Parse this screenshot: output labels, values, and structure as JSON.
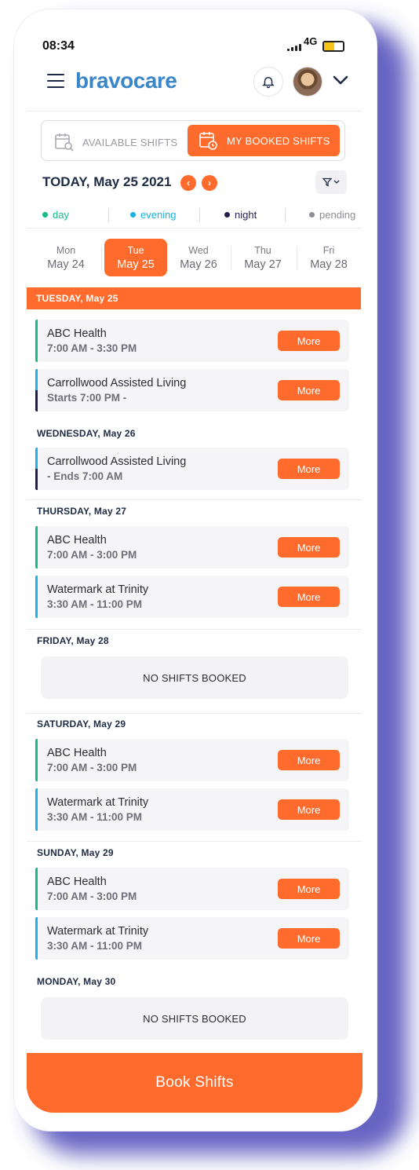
{
  "status_bar": {
    "time": "08:34",
    "network": "4G"
  },
  "header": {
    "logo": "bravocare"
  },
  "toggle": {
    "available": "AVAILABLE SHIFTS",
    "booked": "MY BOOKED SHIFTS"
  },
  "datebar": {
    "today": "TODAY, May 25 2021"
  },
  "legend": [
    {
      "label": "day",
      "color": "#16b98a"
    },
    {
      "label": "evening",
      "color": "#1bb0e3"
    },
    {
      "label": "night",
      "color": "#1f1f4a"
    },
    {
      "label": "pending",
      "color": "#8d8d96"
    }
  ],
  "days": [
    {
      "dow": "Mon",
      "date": "May 24"
    },
    {
      "dow": "Tue",
      "date": "May 25"
    },
    {
      "dow": "Wed",
      "date": "May 26"
    },
    {
      "dow": "Thu",
      "date": "May 27"
    },
    {
      "dow": "Fri",
      "date": "May 28"
    }
  ],
  "sections": {
    "tue": "TUESDAY, May 25",
    "wed": "WEDNESDAY, May 26",
    "thu": "THURSDAY, May 27",
    "fri": "FRIDAY, May 28",
    "sat": "SATURDAY, May 29",
    "sun": "SUNDAY, May 29",
    "mon": "MONDAY, May 30"
  },
  "shifts": {
    "tue1": {
      "name": "ABC Health",
      "time": "7:00 AM - 3:30 PM"
    },
    "tue2": {
      "name": "Carrollwood Assisted Living",
      "time": "Starts 7:00 PM -"
    },
    "wed1": {
      "name": "Carrollwood Assisted Living",
      "time": "- Ends 7:00 AM"
    },
    "thu1": {
      "name": "ABC Health",
      "time": "7:00 AM - 3:00 PM"
    },
    "thu2": {
      "name": "Watermark at Trinity",
      "time": "3:30 AM - 11:00 PM"
    },
    "sat1": {
      "name": "ABC Health",
      "time": "7:00 AM - 3:00 PM"
    },
    "sat2": {
      "name": "Watermark at Trinity",
      "time": "3:30 AM - 11:00 PM"
    },
    "sun1": {
      "name": "ABC Health",
      "time": "7:00 AM - 3:00 PM"
    },
    "sun2": {
      "name": "Watermark at Trinity",
      "time": "3:30 AM - 11:00 PM"
    }
  },
  "more_label": "More",
  "no_shifts": "NO SHIFTS BOOKED",
  "book_button": "Book Shifts",
  "colors": {
    "accent": "#ff6b2c",
    "brand": "#3a86c8"
  }
}
